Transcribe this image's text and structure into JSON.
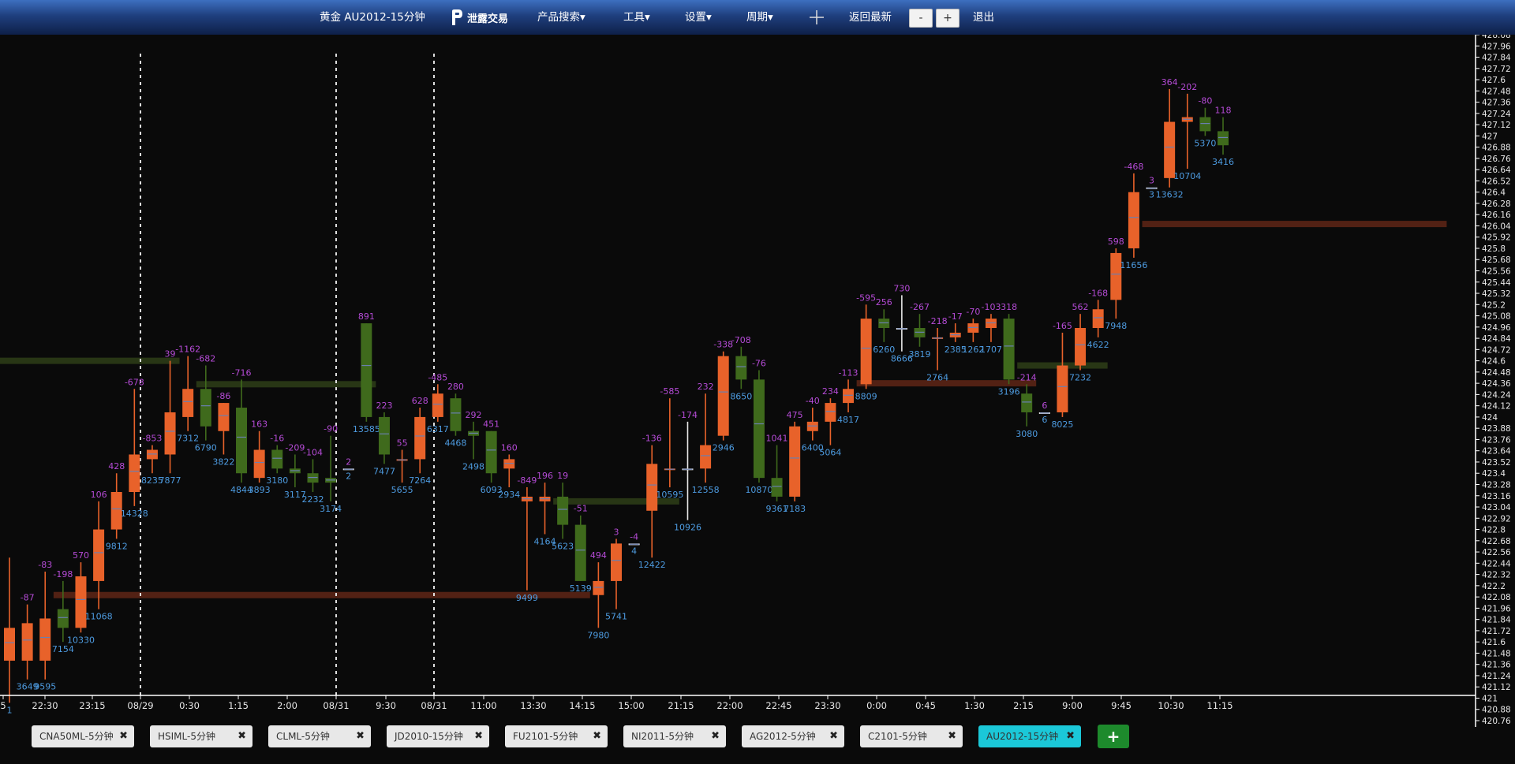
{
  "topbar": {
    "title": "黄金 AU2012-15分钟",
    "logo_text": "泄露交易",
    "menu": [
      "产品搜索▾",
      "工具▾",
      "设置▾",
      "周期▾"
    ],
    "return_latest": "返回最新",
    "zoom_out": "-",
    "zoom_in": "+",
    "exit": "退出"
  },
  "tabs": [
    {
      "label": "CNA50ML-5分钟",
      "active": false
    },
    {
      "label": "HSIML-5分钟",
      "active": false
    },
    {
      "label": "CLML-5分钟",
      "active": false
    },
    {
      "label": "JD2010-15分钟",
      "active": false
    },
    {
      "label": "FU2101-5分钟",
      "active": false
    },
    {
      "label": "NI2011-5分钟",
      "active": false
    },
    {
      "label": "AG2012-5分钟",
      "active": false
    },
    {
      "label": "C2101-5分钟",
      "active": false
    },
    {
      "label": "AU2012-15分钟",
      "active": true
    }
  ],
  "add_tab": "+",
  "close_icon": "✖",
  "colors": {
    "up": "#e8622a",
    "down": "#3f6a1c",
    "delta": "#b54bd6",
    "volume": "#4d9be0",
    "zone_up": "#5a2415",
    "zone_down": "#2b3b16"
  },
  "chart_data": {
    "type": "candlestick",
    "yaxis": {
      "min": 420.76,
      "max": 428.08,
      "step": 0.12,
      "labels": [
        "428.08",
        "427.96",
        "427.84",
        "427.72",
        "427.6",
        "427.48",
        "427.36",
        "427.24",
        "427.12",
        "427",
        "426.88",
        "426.76",
        "426.64",
        "426.52",
        "426.4",
        "426.28",
        "426.16",
        "426.04",
        "425.92",
        "425.8",
        "425.68",
        "425.56",
        "425.44",
        "425.32",
        "425.2",
        "425.08",
        "424.96",
        "424.84",
        "424.72",
        "424.6",
        "424.48",
        "424.36",
        "424.24",
        "424.12",
        "424",
        "423.88",
        "423.76",
        "423.64",
        "423.52",
        "423.4",
        "423.28",
        "423.16",
        "423.04",
        "422.92",
        "422.8",
        "422.68",
        "422.56",
        "422.44",
        "422.32",
        "422.2",
        "422.08",
        "421.96",
        "421.84",
        "421.72",
        "421.6",
        "421.48",
        "421.36",
        "421.24",
        "421.12",
        "421",
        "420.88",
        "420.76"
      ]
    },
    "xaxis": {
      "labels": [
        "5",
        "22:30",
        "23:15",
        "08/29",
        "0:30",
        "1:15",
        "2:00",
        "08/31",
        "9:30",
        "08/31",
        "11:00",
        "13:30",
        "14:15",
        "15:00",
        "21:15",
        "22:00",
        "22:45",
        "23:30",
        "0:00",
        "0:45",
        "1:30",
        "2:15",
        "9:00",
        "9:45",
        "10:30",
        "11:15"
      ]
    },
    "candles": [
      {
        "o": 421.4,
        "h": 422.5,
        "l": 420.95,
        "c": 421.75,
        "d": "",
        "v": "1"
      },
      {
        "o": 421.4,
        "h": 422.0,
        "l": 421.2,
        "c": 421.8,
        "d": "-87",
        "v": "3649"
      },
      {
        "o": 421.4,
        "h": 422.35,
        "l": 421.2,
        "c": 421.85,
        "d": "-83",
        "v": "9595"
      },
      {
        "o": 421.95,
        "h": 422.25,
        "l": 421.6,
        "c": 421.75,
        "d": "-198",
        "v": "7154"
      },
      {
        "o": 421.75,
        "h": 422.45,
        "l": 421.7,
        "c": 422.3,
        "d": "570",
        "v": "10330"
      },
      {
        "o": 422.25,
        "h": 423.1,
        "l": 421.95,
        "c": 422.8,
        "d": "106",
        "v": "11068"
      },
      {
        "o": 422.8,
        "h": 423.4,
        "l": 422.7,
        "c": 423.2,
        "d": "428",
        "v": "9812"
      },
      {
        "o": 423.2,
        "h": 424.3,
        "l": 423.05,
        "c": 423.6,
        "d": "-678",
        "v": "14328"
      },
      {
        "o": 423.55,
        "h": 423.7,
        "l": 423.4,
        "c": 423.65,
        "d": "-853",
        "v": "8235"
      },
      {
        "o": 423.6,
        "h": 424.6,
        "l": 423.4,
        "c": 424.05,
        "d": "39",
        "v": "7877"
      },
      {
        "o": 424.0,
        "h": 424.65,
        "l": 423.85,
        "c": 424.3,
        "d": "-1162",
        "v": "7312"
      },
      {
        "o": 424.3,
        "h": 424.55,
        "l": 423.75,
        "c": 423.9,
        "d": "-682",
        "v": "6790"
      },
      {
        "o": 423.85,
        "h": 424.15,
        "l": 423.6,
        "c": 424.15,
        "d": "-86",
        "v": "3822"
      },
      {
        "o": 424.1,
        "h": 424.4,
        "l": 423.3,
        "c": 423.4,
        "d": "-716",
        "v": "4844"
      },
      {
        "o": 423.35,
        "h": 423.85,
        "l": 423.3,
        "c": 423.65,
        "d": "163",
        "v": "3893"
      },
      {
        "o": 423.65,
        "h": 423.7,
        "l": 423.4,
        "c": 423.45,
        "d": "-16",
        "v": "3180"
      },
      {
        "o": 423.45,
        "h": 423.6,
        "l": 423.25,
        "c": 423.4,
        "d": "-209",
        "v": "3117"
      },
      {
        "o": 423.4,
        "h": 423.55,
        "l": 423.2,
        "c": 423.3,
        "d": "-104",
        "v": "2232"
      },
      {
        "o": 423.35,
        "h": 423.8,
        "l": 423.1,
        "c": 423.3,
        "d": "-90",
        "v": "3174"
      },
      {
        "o": 423.45,
        "h": 423.45,
        "l": 423.45,
        "c": 423.45,
        "d": "2",
        "v": "2",
        "flat": true
      },
      {
        "o": 425.0,
        "h": 425.0,
        "l": 423.95,
        "c": 424.0,
        "d": "891",
        "v": "13585"
      },
      {
        "o": 424.0,
        "h": 424.05,
        "l": 423.5,
        "c": 423.6,
        "d": "223",
        "v": "7477"
      },
      {
        "o": 423.55,
        "h": 423.65,
        "l": 423.3,
        "c": 423.55,
        "d": "55",
        "v": "5655"
      },
      {
        "o": 423.55,
        "h": 424.1,
        "l": 423.4,
        "c": 424.0,
        "d": "628",
        "v": "7264"
      },
      {
        "o": 424.0,
        "h": 424.35,
        "l": 423.95,
        "c": 424.25,
        "d": "-485",
        "v": "6317"
      },
      {
        "o": 424.2,
        "h": 424.25,
        "l": 423.8,
        "c": 423.85,
        "d": "280",
        "v": "4468"
      },
      {
        "o": 423.85,
        "h": 423.95,
        "l": 423.55,
        "c": 423.8,
        "d": "292",
        "v": "2498"
      },
      {
        "o": 423.85,
        "h": 423.85,
        "l": 423.3,
        "c": 423.4,
        "d": "451",
        "v": "6093"
      },
      {
        "o": 423.45,
        "h": 423.6,
        "l": 423.25,
        "c": 423.55,
        "d": "160",
        "v": "2934"
      },
      {
        "o": 423.1,
        "h": 423.25,
        "l": 422.15,
        "c": 423.15,
        "d": "-849",
        "v": "9499"
      },
      {
        "o": 423.1,
        "h": 423.3,
        "l": 422.75,
        "c": 423.15,
        "d": "196",
        "v": "4164"
      },
      {
        "o": 423.15,
        "h": 423.3,
        "l": 422.7,
        "c": 422.85,
        "d": "19",
        "v": "5623"
      },
      {
        "o": 422.85,
        "h": 422.95,
        "l": 422.25,
        "c": 422.25,
        "d": "-51",
        "v": "5139"
      },
      {
        "o": 422.1,
        "h": 422.45,
        "l": 421.75,
        "c": 422.25,
        "d": "494",
        "v": "7980"
      },
      {
        "o": 422.25,
        "h": 422.7,
        "l": 421.95,
        "c": 422.65,
        "d": "3",
        "v": "5741"
      },
      {
        "o": 422.65,
        "h": 422.65,
        "l": 422.65,
        "c": 422.65,
        "d": "-4",
        "v": "4",
        "flat": true
      },
      {
        "o": 423.0,
        "h": 423.7,
        "l": 422.5,
        "c": 423.5,
        "d": "-136",
        "v": "12422"
      },
      {
        "o": 423.45,
        "h": 424.2,
        "l": 423.25,
        "c": 423.45,
        "d": "-585",
        "v": "10595"
      },
      {
        "o": 423.45,
        "h": 423.95,
        "l": 422.9,
        "c": 423.45,
        "d": "-174",
        "v": "10926",
        "flat": true
      },
      {
        "o": 423.45,
        "h": 424.25,
        "l": 423.3,
        "c": 423.7,
        "d": "232",
        "v": "12558"
      },
      {
        "o": 423.8,
        "h": 424.7,
        "l": 423.75,
        "c": 424.65,
        "d": "-338",
        "v": "2946"
      },
      {
        "o": 424.65,
        "h": 424.75,
        "l": 424.3,
        "c": 424.4,
        "d": "-708",
        "v": "8650"
      },
      {
        "o": 424.4,
        "h": 424.5,
        "l": 423.3,
        "c": 423.35,
        "d": "-76",
        "v": "10870"
      },
      {
        "o": 423.35,
        "h": 423.7,
        "l": 423.1,
        "c": 423.15,
        "d": "1041",
        "v": "9361"
      },
      {
        "o": 423.15,
        "h": 423.95,
        "l": 423.1,
        "c": 423.9,
        "d": "475",
        "v": "7183"
      },
      {
        "o": 423.85,
        "h": 424.1,
        "l": 423.75,
        "c": 423.95,
        "d": "-40",
        "v": "6400"
      },
      {
        "o": 423.95,
        "h": 424.2,
        "l": 423.7,
        "c": 424.15,
        "d": "234",
        "v": "5064"
      },
      {
        "o": 424.15,
        "h": 424.4,
        "l": 424.05,
        "c": 424.3,
        "d": "-113",
        "v": "4817"
      },
      {
        "o": 424.35,
        "h": 425.2,
        "l": 424.3,
        "c": 425.05,
        "d": "-595",
        "v": "8809"
      },
      {
        "o": 425.05,
        "h": 425.15,
        "l": 424.8,
        "c": 424.95,
        "d": "256",
        "v": "6260"
      },
      {
        "o": 424.95,
        "h": 425.3,
        "l": 424.7,
        "c": 424.95,
        "d": "730",
        "v": "8666",
        "flat": true
      },
      {
        "o": 424.95,
        "h": 425.1,
        "l": 424.75,
        "c": 424.85,
        "d": "-267",
        "v": "3819"
      },
      {
        "o": 424.85,
        "h": 424.95,
        "l": 424.5,
        "c": 424.85,
        "d": "-218",
        "v": "2764"
      },
      {
        "o": 424.85,
        "h": 425.0,
        "l": 424.8,
        "c": 424.9,
        "d": "-17",
        "v": "2385"
      },
      {
        "o": 424.9,
        "h": 425.05,
        "l": 424.8,
        "c": 425.0,
        "d": "-70",
        "v": "1262"
      },
      {
        "o": 424.95,
        "h": 425.1,
        "l": 424.8,
        "c": 425.05,
        "d": "-103",
        "v": "1707"
      },
      {
        "o": 425.05,
        "h": 425.1,
        "l": 424.35,
        "c": 424.4,
        "d": "318",
        "v": "3196"
      },
      {
        "o": 424.25,
        "h": 424.35,
        "l": 423.9,
        "c": 424.05,
        "d": "-214",
        "v": "3080"
      },
      {
        "o": 424.05,
        "h": 424.05,
        "l": 424.05,
        "c": 424.05,
        "d": "6",
        "v": "6",
        "flat": true
      },
      {
        "o": 424.05,
        "h": 424.9,
        "l": 424.0,
        "c": 424.55,
        "d": "-165",
        "v": "8025"
      },
      {
        "o": 424.55,
        "h": 425.1,
        "l": 424.5,
        "c": 424.95,
        "d": "562",
        "v": "7232"
      },
      {
        "o": 424.95,
        "h": 425.25,
        "l": 424.85,
        "c": 425.15,
        "d": "-168",
        "v": "4622"
      },
      {
        "o": 425.25,
        "h": 425.8,
        "l": 425.05,
        "c": 425.75,
        "d": "598",
        "v": "7948"
      },
      {
        "o": 425.8,
        "h": 426.6,
        "l": 425.7,
        "c": 426.4,
        "d": "-468",
        "v": "11656"
      },
      {
        "o": 426.45,
        "h": 426.45,
        "l": 426.45,
        "c": 426.45,
        "d": "3",
        "v": "3",
        "flat": true
      },
      {
        "o": 426.55,
        "h": 427.5,
        "l": 426.45,
        "c": 427.15,
        "d": "364",
        "v": "13632"
      },
      {
        "o": 427.15,
        "h": 427.45,
        "l": 426.65,
        "c": 427.2,
        "d": "-202",
        "v": "10704"
      },
      {
        "o": 427.2,
        "h": 427.3,
        "l": 427.0,
        "c": 427.05,
        "d": "-80",
        "v": "5370"
      },
      {
        "o": 427.05,
        "h": 427.2,
        "l": 426.8,
        "c": 426.9,
        "d": "118",
        "v": "3416"
      }
    ],
    "zones": [
      {
        "from": 0,
        "to": 9,
        "price": 424.6,
        "dir": "down"
      },
      {
        "from": 11,
        "to": 20,
        "price": 424.35,
        "dir": "down"
      },
      {
        "from": 3,
        "to": 32,
        "price": 422.1,
        "dir": "up"
      },
      {
        "from": 31,
        "to": 37,
        "price": 423.1,
        "dir": "down"
      },
      {
        "from": 48,
        "to": 57,
        "price": 424.36,
        "dir": "up"
      },
      {
        "from": 57,
        "to": 61,
        "price": 424.55,
        "dir": "down"
      },
      {
        "from": 64,
        "to": 80,
        "price": 426.06,
        "dir": "up"
      }
    ]
  }
}
